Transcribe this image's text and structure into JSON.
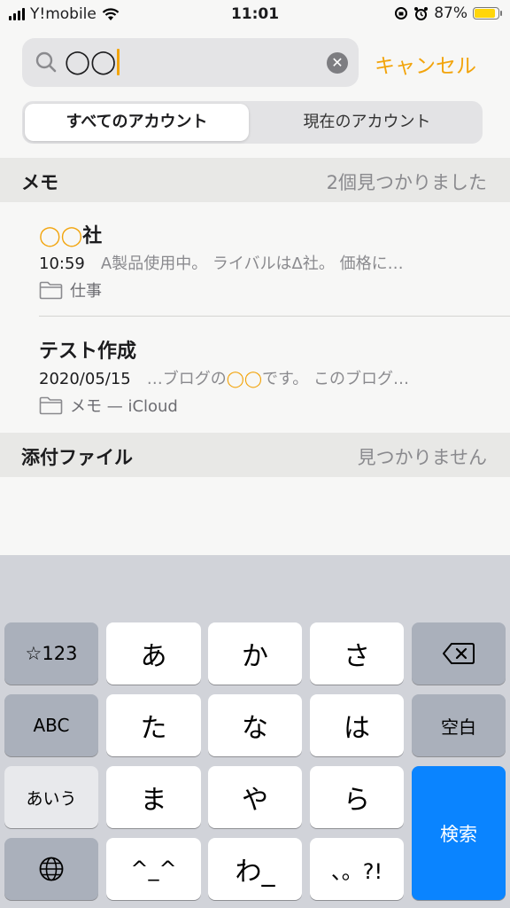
{
  "status": {
    "carrier": "Y!mobile",
    "time": "11:01",
    "battery": "87%",
    "battery_level": 0.87
  },
  "search": {
    "query": "◯◯",
    "cancel_label": "キャンセル"
  },
  "segments": {
    "all_accounts": "すべてのアカウント",
    "current_account": "現在のアカウント"
  },
  "memo_section": {
    "title": "メモ",
    "count": "2個見つかりました"
  },
  "notes": [
    {
      "title": "◯◯",
      "title_suffix": "社",
      "date": "10:59",
      "preview": "A製品使用中。 ライバルはΔ社。 価格に…",
      "folder": "仕事"
    },
    {
      "title": "テスト作成",
      "date": "2020/05/15",
      "preview_before": "…ブログの",
      "preview_highlight": "◯◯",
      "preview_after": "です。 このブログ…",
      "folder": "メモ — iCloud"
    }
  ],
  "attachments_section": {
    "title": "添付ファイル",
    "status": "見つかりません"
  },
  "keyboard": {
    "num_key": "☆123",
    "abc_key": "ABC",
    "aiu_key": "あいう",
    "a": "あ",
    "ka": "か",
    "sa": "さ",
    "ta": "た",
    "na": "な",
    "ha": "は",
    "ma": "ま",
    "ya": "や",
    "ra": "ら",
    "emoticon": "^_^",
    "wa": "わ_",
    "punct": "、。?!",
    "space": "空白",
    "search": "検索"
  }
}
